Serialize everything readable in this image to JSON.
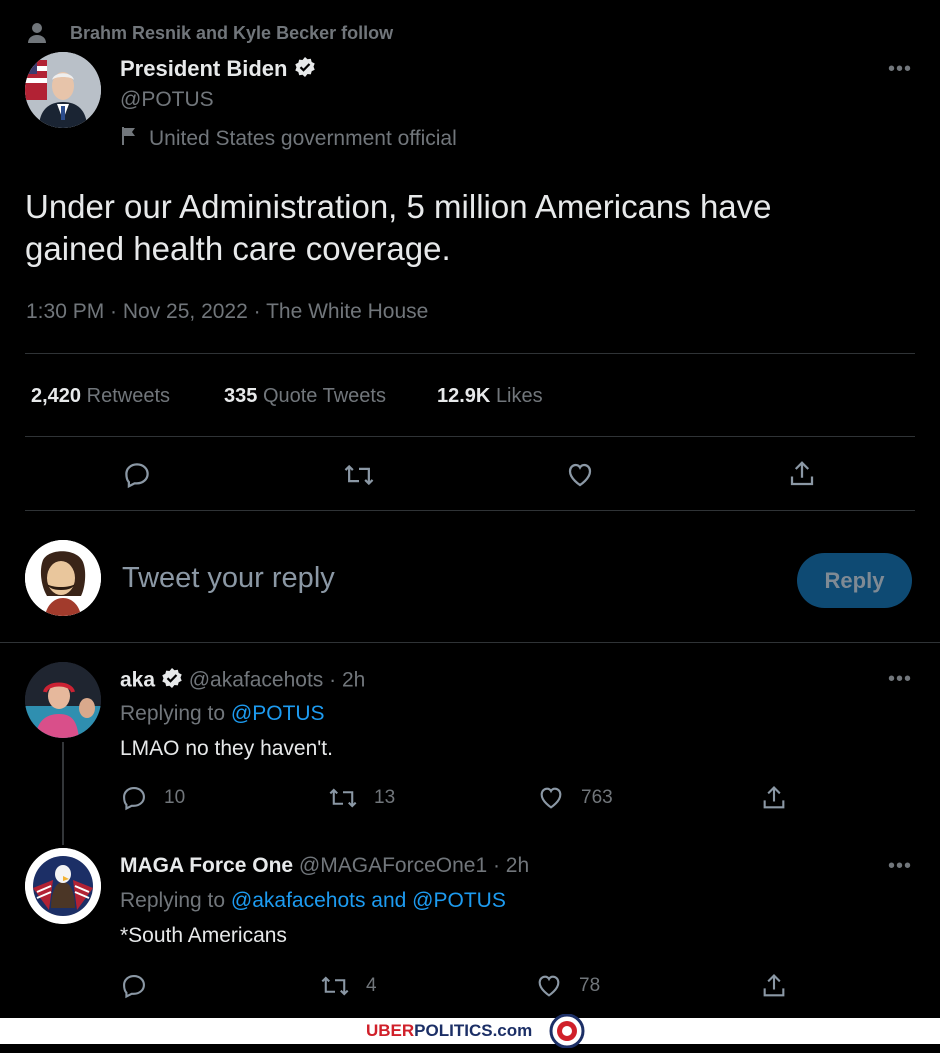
{
  "social_context": "Brahm Resnik and Kyle Becker follow",
  "main_tweet": {
    "display_name": "President Biden",
    "handle": "@POTUS",
    "label": "United States government official",
    "text_line1": "Under our Administration, 5 million Americans have",
    "text_line2": "gained health care coverage.",
    "meta": "1:30 PM · Nov 25, 2022 · The White House",
    "retweets_count": "2,420",
    "retweets_label": "Retweets",
    "quotes_count": "335",
    "quotes_label": "Quote Tweets",
    "likes_count": "12.9K",
    "likes_label": "Likes"
  },
  "composer": {
    "placeholder": "Tweet your reply",
    "button_label": "Reply"
  },
  "replies": [
    {
      "display_name": "aka",
      "handle_time": "@akafacehots · 2h",
      "replying_prefix": "Replying to",
      "replying_to": "@POTUS",
      "text": "LMAO no they haven't.",
      "reply_count": "10",
      "retweet_count": "13",
      "like_count": "763"
    },
    {
      "display_name": "MAGA Force One",
      "handle_time": "@MAGAForceOne1 · 2h",
      "replying_prefix": "Replying to",
      "replying_to": "@akafacehots and @POTUS",
      "text": "*South Americans",
      "reply_count": "",
      "retweet_count": "4",
      "like_count": "78"
    }
  ],
  "watermark": {
    "part1": "UBER",
    "part2": "POLITICS",
    "part3": ".com"
  },
  "colors": {
    "background": "#000000",
    "text": "#e7e9ea",
    "muted": "#71767b",
    "link": "#1d9bf0",
    "divider": "#2f3336"
  }
}
